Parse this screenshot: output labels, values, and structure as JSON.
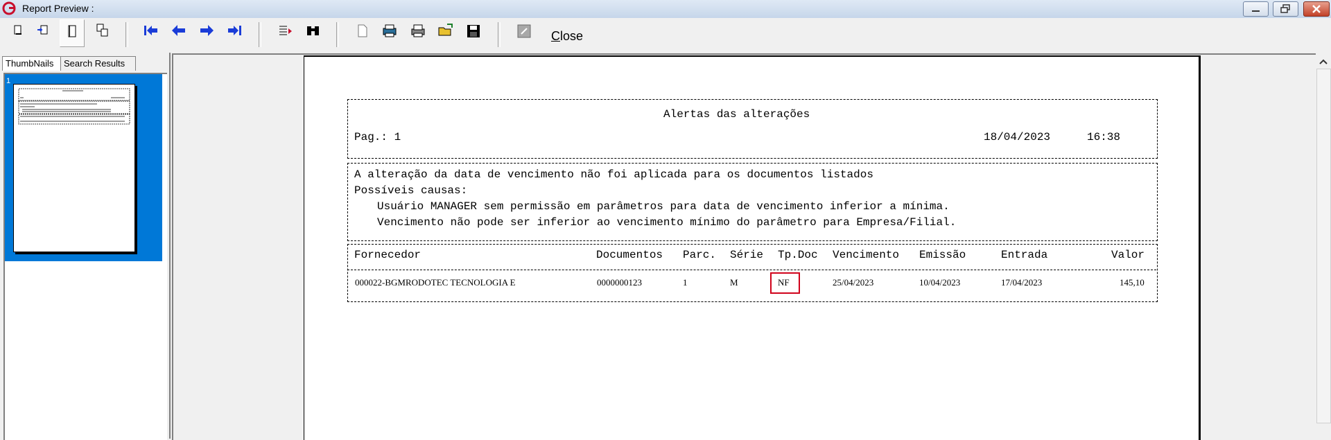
{
  "window": {
    "title": "Report Preview :",
    "close_label_mnemonic": "C",
    "close_label_rest": "lose"
  },
  "tabs": [
    {
      "label": "ThumbNails"
    },
    {
      "label": "Search Results"
    }
  ],
  "thumbnail": {
    "page_number": "1"
  },
  "report": {
    "title": "Alertas das alterações",
    "page_label": "Pag.: 1",
    "date": "18/04/2023",
    "time": "16:38",
    "message_line1": "A alteração da data de vencimento não foi aplicada para os documentos listados",
    "message_line2": "Possíveis causas:",
    "message_line3": "Usuário MANAGER sem permissão em parâmetros para data de vencimento inferior a mínima.",
    "message_line4": "Vencimento não pode ser inferior ao vencimento mínimo do parâmetro para Empresa/Filial.",
    "columns": {
      "fornecedor": "Fornecedor",
      "documentos": "Documentos",
      "parc": "Parc.",
      "serie": "Série",
      "tpdoc": "Tp.Doc",
      "vencimento": "Vencimento",
      "emissao": "Emissão",
      "entrada": "Entrada",
      "valor": "Valor"
    },
    "row": {
      "fornecedor": "000022-BGMRODOTEC TECNOLOGIA E",
      "documentos": "0000000123",
      "parc": "1",
      "serie": "M",
      "tpdoc": "NF",
      "vencimento": "25/04/2023",
      "emissao": "10/04/2023",
      "entrada": "17/04/2023",
      "valor": "145,10"
    }
  },
  "colors": {
    "selection": "#0078d7",
    "highlight_box": "#d0021b",
    "toolbar_blue": "#1a3cd8"
  }
}
